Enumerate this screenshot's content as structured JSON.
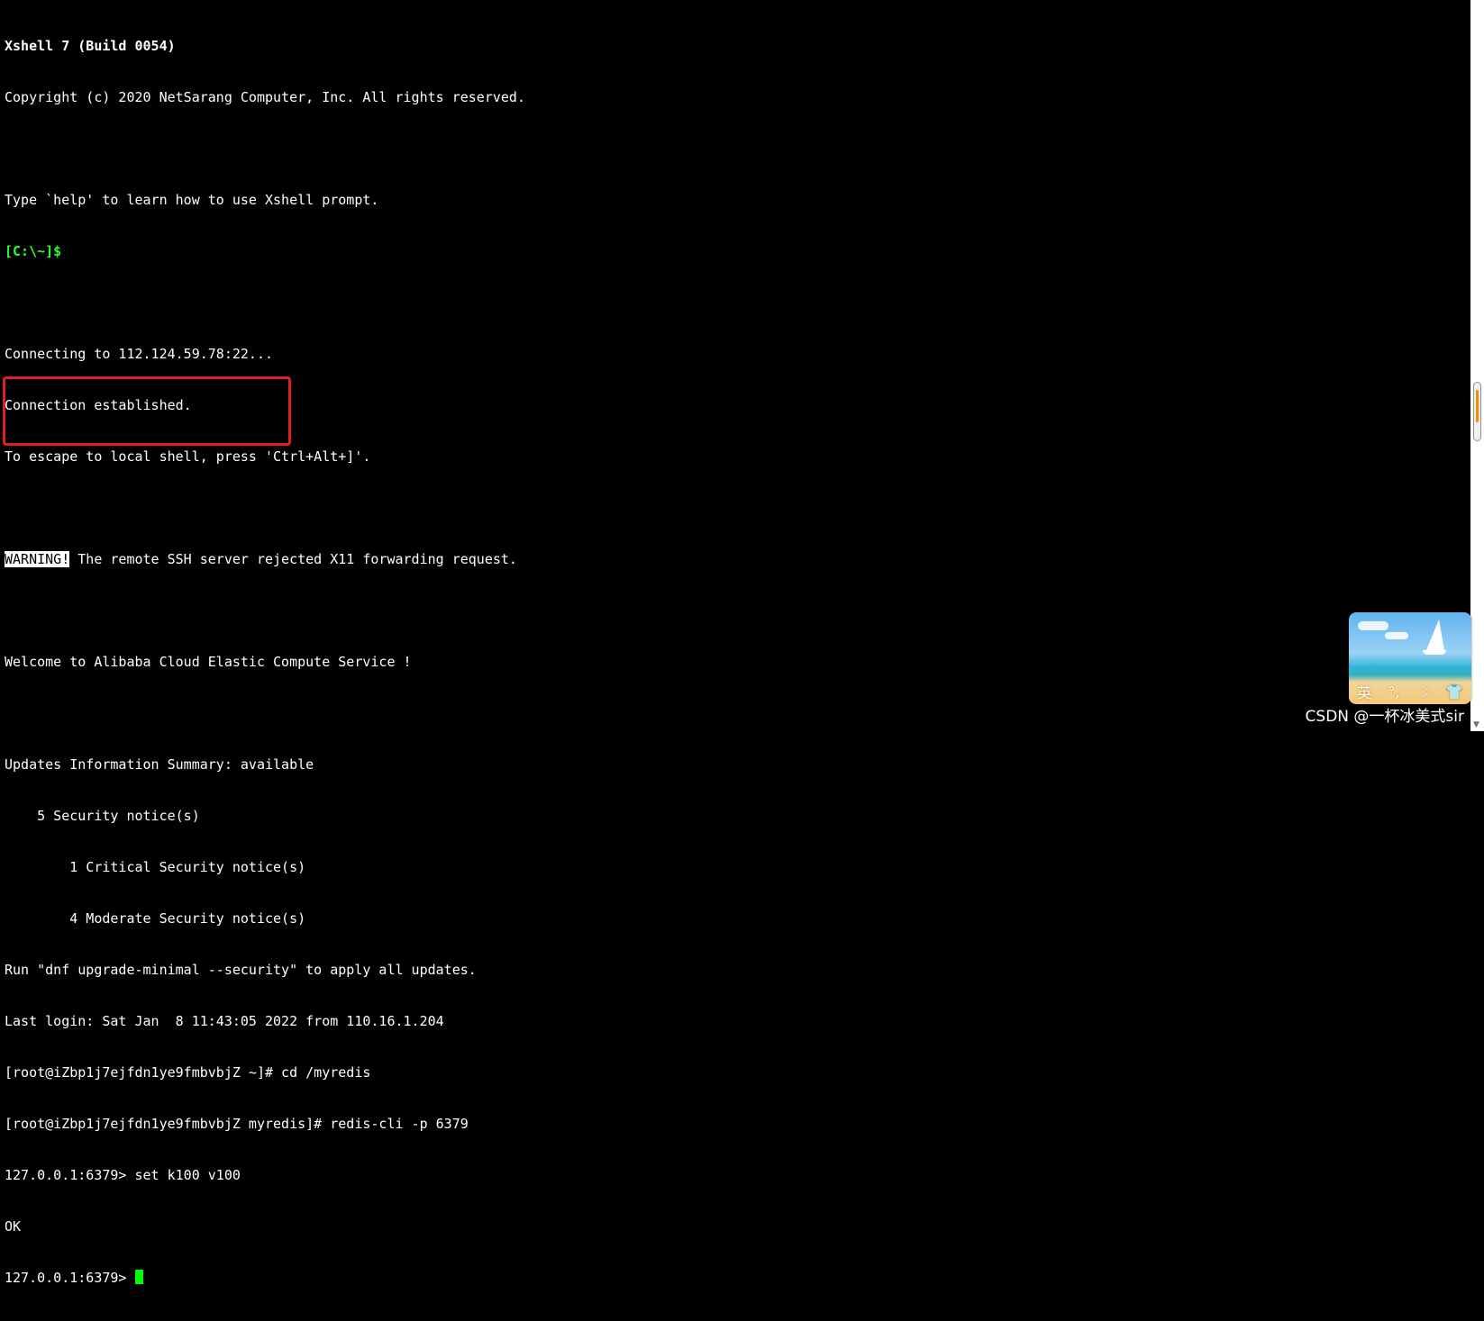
{
  "terminal": {
    "lines": [
      "Xshell 7 (Build 0054)",
      "Copyright (c) 2020 NetSarang Computer, Inc. All rights reserved.",
      "",
      "Type `help' to learn how to use Xshell prompt.",
      "[C:\\~]$",
      "",
      "Connecting to 112.124.59.78:22...",
      "Connection established.",
      "To escape to local shell, press 'Ctrl+Alt+]'.",
      "",
      "The remote SSH server rejected X11 forwarding request.",
      "",
      "Welcome to Alibaba Cloud Elastic Compute Service !",
      "",
      "Updates Information Summary: available",
      "    5 Security notice(s)",
      "        1 Critical Security notice(s)",
      "        4 Moderate Security notice(s)",
      "Run \"dnf upgrade-minimal --security\" to apply all updates.",
      "Last login: Sat Jan  8 11:43:05 2022 from 110.16.1.204",
      "[root@iZbp1j7ejfdn1ye9fmbvbjZ ~]# cd /myredis",
      "[root@iZbp1j7ejfdn1ye9fmbvbjZ myredis]# redis-cli -p 6379",
      "127.0.0.1:6379> set k100 v100",
      "OK",
      "127.0.0.1:6379> "
    ],
    "warning_label": "WARNING!"
  },
  "ime": {
    "label": "英",
    "icon_names": [
      "moon-icon",
      "shirt-icon"
    ]
  },
  "watermark": "CSDN @一杯冰美式sir",
  "colors": {
    "background": "#000000",
    "text": "#ffffff",
    "prompt_green": "#28ff28",
    "cursor": "#00ff00",
    "highlight_border": "#e02020",
    "scroll_accent": "#ff8a00"
  }
}
